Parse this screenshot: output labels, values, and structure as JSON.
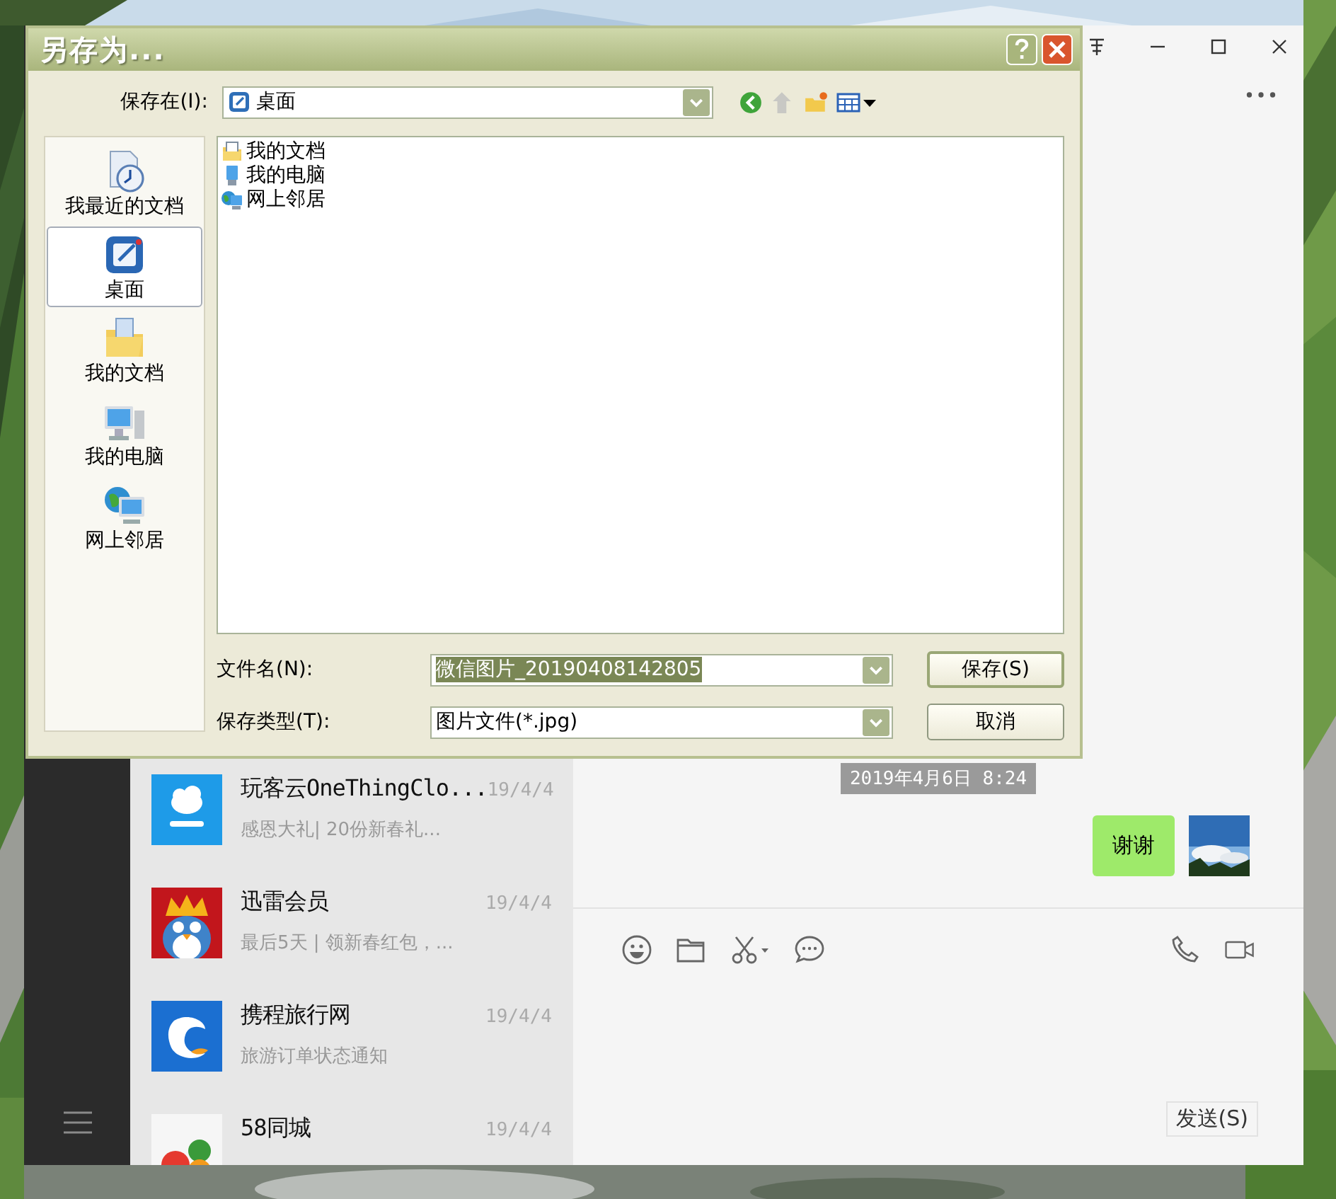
{
  "dialog": {
    "title": "另存为...",
    "save_in": {
      "label": "保存在(I):",
      "value": "桌面"
    },
    "places": [
      {
        "label": "我最近的文档",
        "kind": "recent",
        "selected": false
      },
      {
        "label": "桌面",
        "kind": "desktop",
        "selected": true
      },
      {
        "label": "我的文档",
        "kind": "documents",
        "selected": false
      },
      {
        "label": "我的电脑",
        "kind": "computer",
        "selected": false
      },
      {
        "label": "网上邻居",
        "kind": "network",
        "selected": false
      }
    ],
    "files": [
      {
        "name": "我的文档",
        "kind": "documents"
      },
      {
        "name": "我的电脑",
        "kind": "computer"
      },
      {
        "name": "网上邻居",
        "kind": "network"
      }
    ],
    "file_name": {
      "label": "文件名(N):",
      "value": "微信图片_20190408142805",
      "selected": true
    },
    "file_type": {
      "label": "保存类型(T):",
      "value": "图片文件(*.jpg)"
    },
    "buttons": [
      {
        "label": "保存(S)",
        "default": true
      },
      {
        "label": "取消",
        "default": false
      }
    ]
  },
  "chat_app": {
    "chats": [
      {
        "name": "玩客云OneThingClo...",
        "preview": "感恩大礼| 20份新春礼...",
        "date": "19/4/4",
        "kind": "cloud"
      },
      {
        "name": "迅雷会员",
        "preview": "最后5天 | 领新春红包，...",
        "date": "19/4/4",
        "kind": "vip"
      },
      {
        "name": "携程旅行网",
        "preview": "旅游订单状态通知",
        "date": "19/4/4",
        "kind": "dolphin"
      },
      {
        "name": "58同城",
        "date": "19/4/4",
        "kind": "fifty_eight"
      }
    ],
    "timestamp": "2019年4月6日 8:24",
    "messages": [
      {
        "text": "谢谢",
        "outgoing": true
      }
    ],
    "send_button": "发送(S)"
  }
}
